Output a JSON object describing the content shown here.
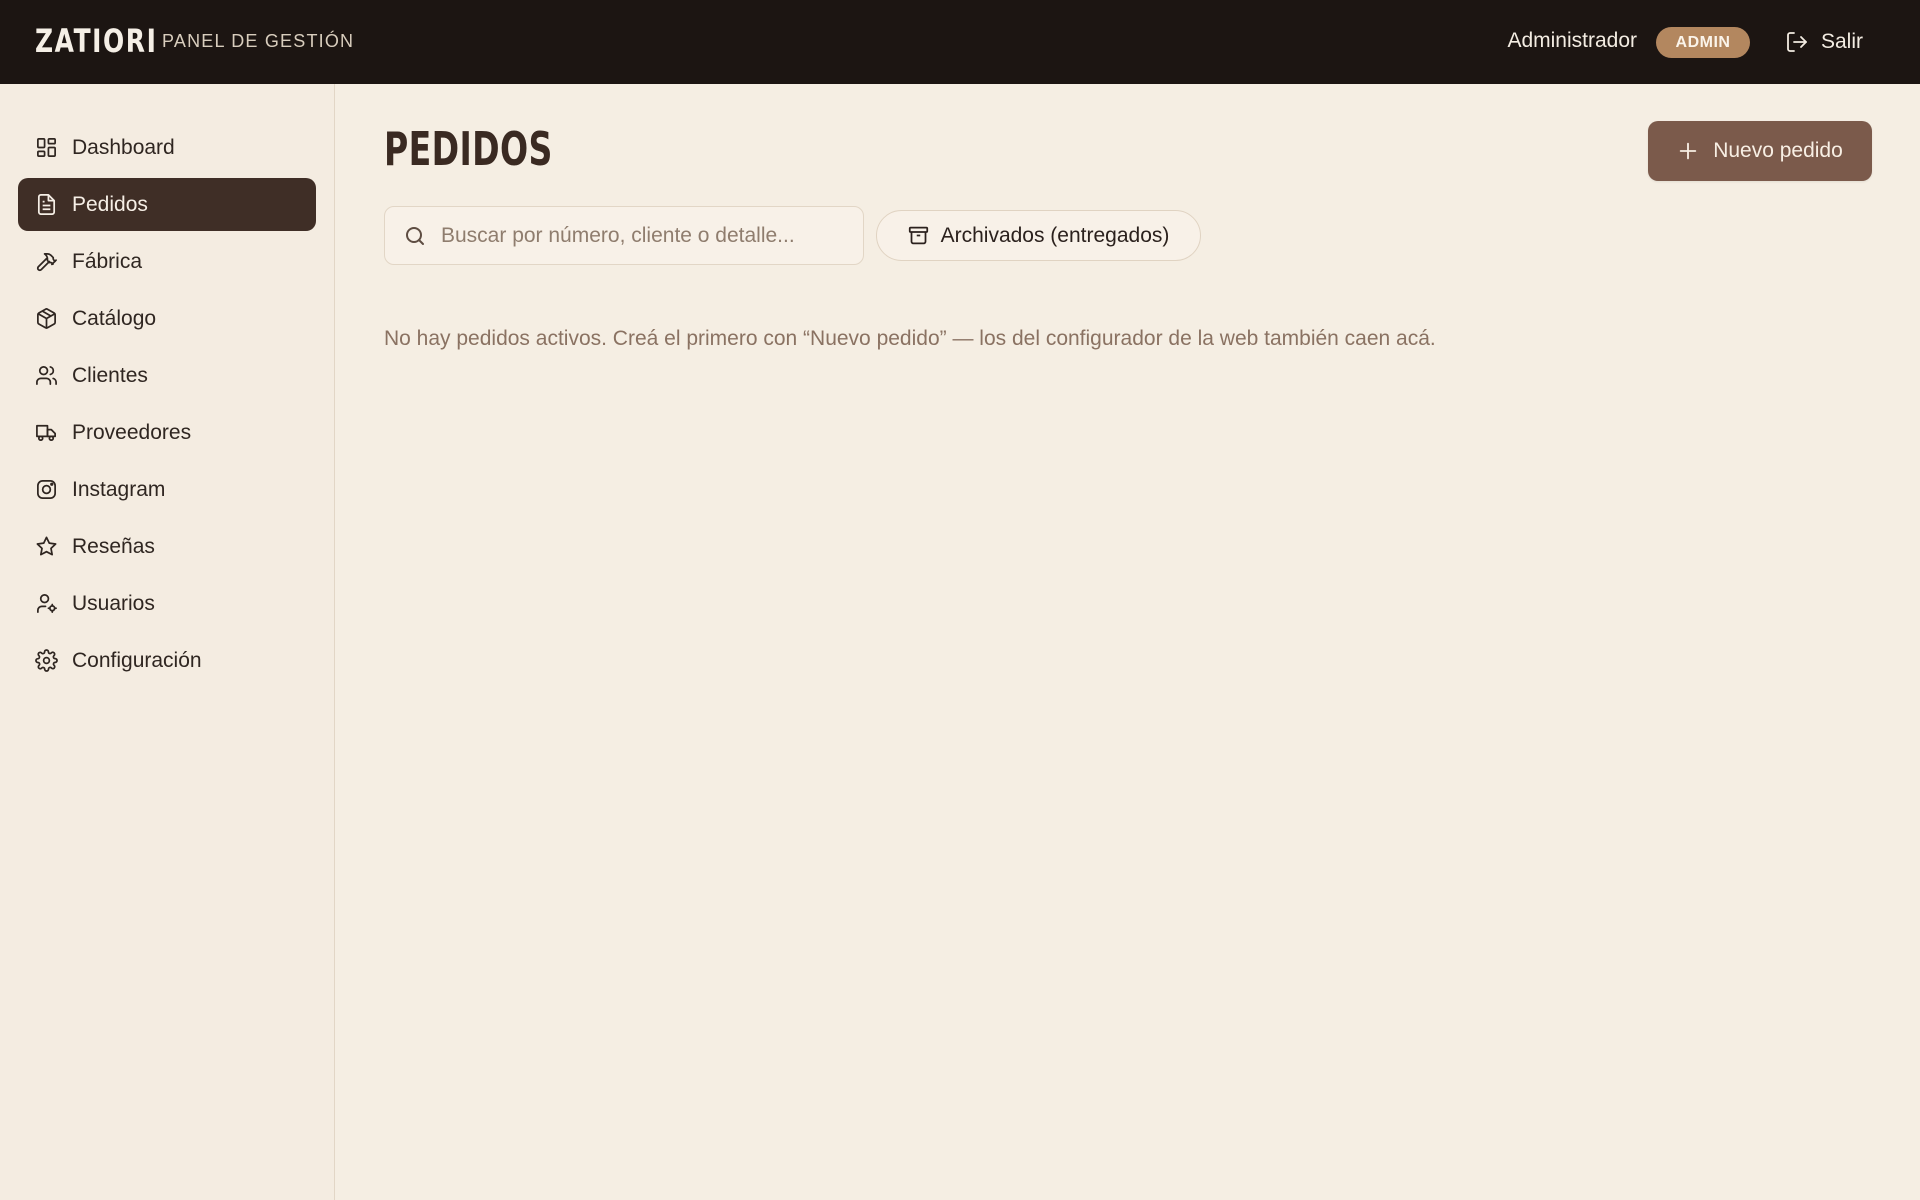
{
  "header": {
    "brand": "ZATIORI",
    "subtitle": "PANEL DE GESTIÓN",
    "user_name": "Administrador",
    "role_badge": "ADMIN",
    "logout_label": "Salir"
  },
  "sidebar": {
    "items": [
      {
        "label": "Dashboard",
        "icon": "dashboard-icon",
        "active": false
      },
      {
        "label": "Pedidos",
        "icon": "document-icon",
        "active": true
      },
      {
        "label": "Fábrica",
        "icon": "hammer-icon",
        "active": false
      },
      {
        "label": "Catálogo",
        "icon": "package-icon",
        "active": false
      },
      {
        "label": "Clientes",
        "icon": "users-icon",
        "active": false
      },
      {
        "label": "Proveedores",
        "icon": "truck-icon",
        "active": false
      },
      {
        "label": "Instagram",
        "icon": "instagram-icon",
        "active": false
      },
      {
        "label": "Reseñas",
        "icon": "star-icon",
        "active": false
      },
      {
        "label": "Usuarios",
        "icon": "user-cog-icon",
        "active": false
      },
      {
        "label": "Configuración",
        "icon": "gear-icon",
        "active": false
      }
    ]
  },
  "main": {
    "title": "PEDIDOS",
    "new_button_label": "Nuevo pedido",
    "search_placeholder": "Buscar por número, cliente o detalle...",
    "search_value": "",
    "archive_button_label": "Archivados (entregados)",
    "empty_message": "No hay pedidos activos. Creá el primero con “Nuevo pedido” — los del configurador de la web también caen acá."
  },
  "colors": {
    "topbar": "#1c1512",
    "background": "#f5eee3",
    "active_nav": "#3f2e26",
    "primary_button": "#7b5a4b",
    "badge": "#b3875f",
    "muted_text": "#8a7262"
  }
}
